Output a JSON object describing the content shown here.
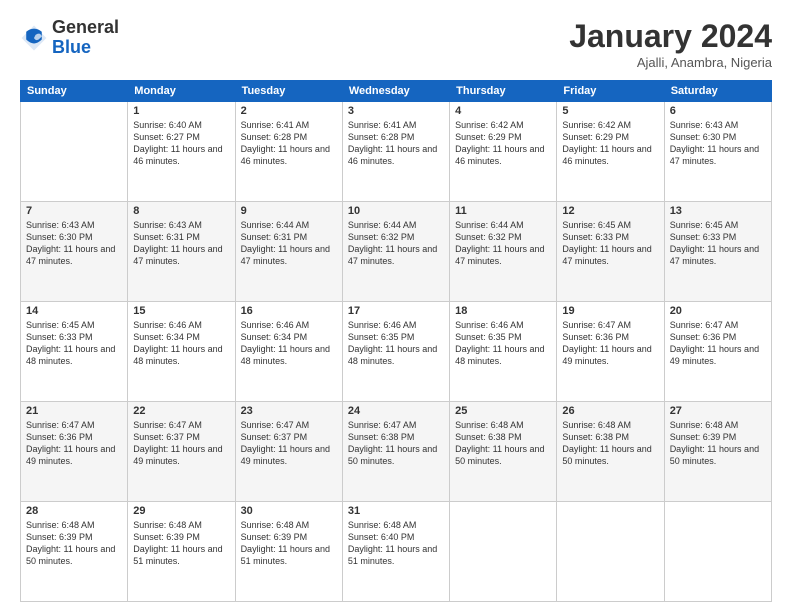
{
  "header": {
    "logo_general": "General",
    "logo_blue": "Blue",
    "month_title": "January 2024",
    "location": "Ajalli, Anambra, Nigeria"
  },
  "days_of_week": [
    "Sunday",
    "Monday",
    "Tuesday",
    "Wednesday",
    "Thursday",
    "Friday",
    "Saturday"
  ],
  "weeks": [
    [
      {
        "day": "",
        "sunrise": "",
        "sunset": "",
        "daylight": ""
      },
      {
        "day": "1",
        "sunrise": "Sunrise: 6:40 AM",
        "sunset": "Sunset: 6:27 PM",
        "daylight": "Daylight: 11 hours and 46 minutes."
      },
      {
        "day": "2",
        "sunrise": "Sunrise: 6:41 AM",
        "sunset": "Sunset: 6:28 PM",
        "daylight": "Daylight: 11 hours and 46 minutes."
      },
      {
        "day": "3",
        "sunrise": "Sunrise: 6:41 AM",
        "sunset": "Sunset: 6:28 PM",
        "daylight": "Daylight: 11 hours and 46 minutes."
      },
      {
        "day": "4",
        "sunrise": "Sunrise: 6:42 AM",
        "sunset": "Sunset: 6:29 PM",
        "daylight": "Daylight: 11 hours and 46 minutes."
      },
      {
        "day": "5",
        "sunrise": "Sunrise: 6:42 AM",
        "sunset": "Sunset: 6:29 PM",
        "daylight": "Daylight: 11 hours and 46 minutes."
      },
      {
        "day": "6",
        "sunrise": "Sunrise: 6:43 AM",
        "sunset": "Sunset: 6:30 PM",
        "daylight": "Daylight: 11 hours and 47 minutes."
      }
    ],
    [
      {
        "day": "7",
        "sunrise": "Sunrise: 6:43 AM",
        "sunset": "Sunset: 6:30 PM",
        "daylight": "Daylight: 11 hours and 47 minutes."
      },
      {
        "day": "8",
        "sunrise": "Sunrise: 6:43 AM",
        "sunset": "Sunset: 6:31 PM",
        "daylight": "Daylight: 11 hours and 47 minutes."
      },
      {
        "day": "9",
        "sunrise": "Sunrise: 6:44 AM",
        "sunset": "Sunset: 6:31 PM",
        "daylight": "Daylight: 11 hours and 47 minutes."
      },
      {
        "day": "10",
        "sunrise": "Sunrise: 6:44 AM",
        "sunset": "Sunset: 6:32 PM",
        "daylight": "Daylight: 11 hours and 47 minutes."
      },
      {
        "day": "11",
        "sunrise": "Sunrise: 6:44 AM",
        "sunset": "Sunset: 6:32 PM",
        "daylight": "Daylight: 11 hours and 47 minutes."
      },
      {
        "day": "12",
        "sunrise": "Sunrise: 6:45 AM",
        "sunset": "Sunset: 6:33 PM",
        "daylight": "Daylight: 11 hours and 47 minutes."
      },
      {
        "day": "13",
        "sunrise": "Sunrise: 6:45 AM",
        "sunset": "Sunset: 6:33 PM",
        "daylight": "Daylight: 11 hours and 47 minutes."
      }
    ],
    [
      {
        "day": "14",
        "sunrise": "Sunrise: 6:45 AM",
        "sunset": "Sunset: 6:33 PM",
        "daylight": "Daylight: 11 hours and 48 minutes."
      },
      {
        "day": "15",
        "sunrise": "Sunrise: 6:46 AM",
        "sunset": "Sunset: 6:34 PM",
        "daylight": "Daylight: 11 hours and 48 minutes."
      },
      {
        "day": "16",
        "sunrise": "Sunrise: 6:46 AM",
        "sunset": "Sunset: 6:34 PM",
        "daylight": "Daylight: 11 hours and 48 minutes."
      },
      {
        "day": "17",
        "sunrise": "Sunrise: 6:46 AM",
        "sunset": "Sunset: 6:35 PM",
        "daylight": "Daylight: 11 hours and 48 minutes."
      },
      {
        "day": "18",
        "sunrise": "Sunrise: 6:46 AM",
        "sunset": "Sunset: 6:35 PM",
        "daylight": "Daylight: 11 hours and 48 minutes."
      },
      {
        "day": "19",
        "sunrise": "Sunrise: 6:47 AM",
        "sunset": "Sunset: 6:36 PM",
        "daylight": "Daylight: 11 hours and 49 minutes."
      },
      {
        "day": "20",
        "sunrise": "Sunrise: 6:47 AM",
        "sunset": "Sunset: 6:36 PM",
        "daylight": "Daylight: 11 hours and 49 minutes."
      }
    ],
    [
      {
        "day": "21",
        "sunrise": "Sunrise: 6:47 AM",
        "sunset": "Sunset: 6:36 PM",
        "daylight": "Daylight: 11 hours and 49 minutes."
      },
      {
        "day": "22",
        "sunrise": "Sunrise: 6:47 AM",
        "sunset": "Sunset: 6:37 PM",
        "daylight": "Daylight: 11 hours and 49 minutes."
      },
      {
        "day": "23",
        "sunrise": "Sunrise: 6:47 AM",
        "sunset": "Sunset: 6:37 PM",
        "daylight": "Daylight: 11 hours and 49 minutes."
      },
      {
        "day": "24",
        "sunrise": "Sunrise: 6:47 AM",
        "sunset": "Sunset: 6:38 PM",
        "daylight": "Daylight: 11 hours and 50 minutes."
      },
      {
        "day": "25",
        "sunrise": "Sunrise: 6:48 AM",
        "sunset": "Sunset: 6:38 PM",
        "daylight": "Daylight: 11 hours and 50 minutes."
      },
      {
        "day": "26",
        "sunrise": "Sunrise: 6:48 AM",
        "sunset": "Sunset: 6:38 PM",
        "daylight": "Daylight: 11 hours and 50 minutes."
      },
      {
        "day": "27",
        "sunrise": "Sunrise: 6:48 AM",
        "sunset": "Sunset: 6:39 PM",
        "daylight": "Daylight: 11 hours and 50 minutes."
      }
    ],
    [
      {
        "day": "28",
        "sunrise": "Sunrise: 6:48 AM",
        "sunset": "Sunset: 6:39 PM",
        "daylight": "Daylight: 11 hours and 50 minutes."
      },
      {
        "day": "29",
        "sunrise": "Sunrise: 6:48 AM",
        "sunset": "Sunset: 6:39 PM",
        "daylight": "Daylight: 11 hours and 51 minutes."
      },
      {
        "day": "30",
        "sunrise": "Sunrise: 6:48 AM",
        "sunset": "Sunset: 6:39 PM",
        "daylight": "Daylight: 11 hours and 51 minutes."
      },
      {
        "day": "31",
        "sunrise": "Sunrise: 6:48 AM",
        "sunset": "Sunset: 6:40 PM",
        "daylight": "Daylight: 11 hours and 51 minutes."
      },
      {
        "day": "",
        "sunrise": "",
        "sunset": "",
        "daylight": ""
      },
      {
        "day": "",
        "sunrise": "",
        "sunset": "",
        "daylight": ""
      },
      {
        "day": "",
        "sunrise": "",
        "sunset": "",
        "daylight": ""
      }
    ]
  ]
}
